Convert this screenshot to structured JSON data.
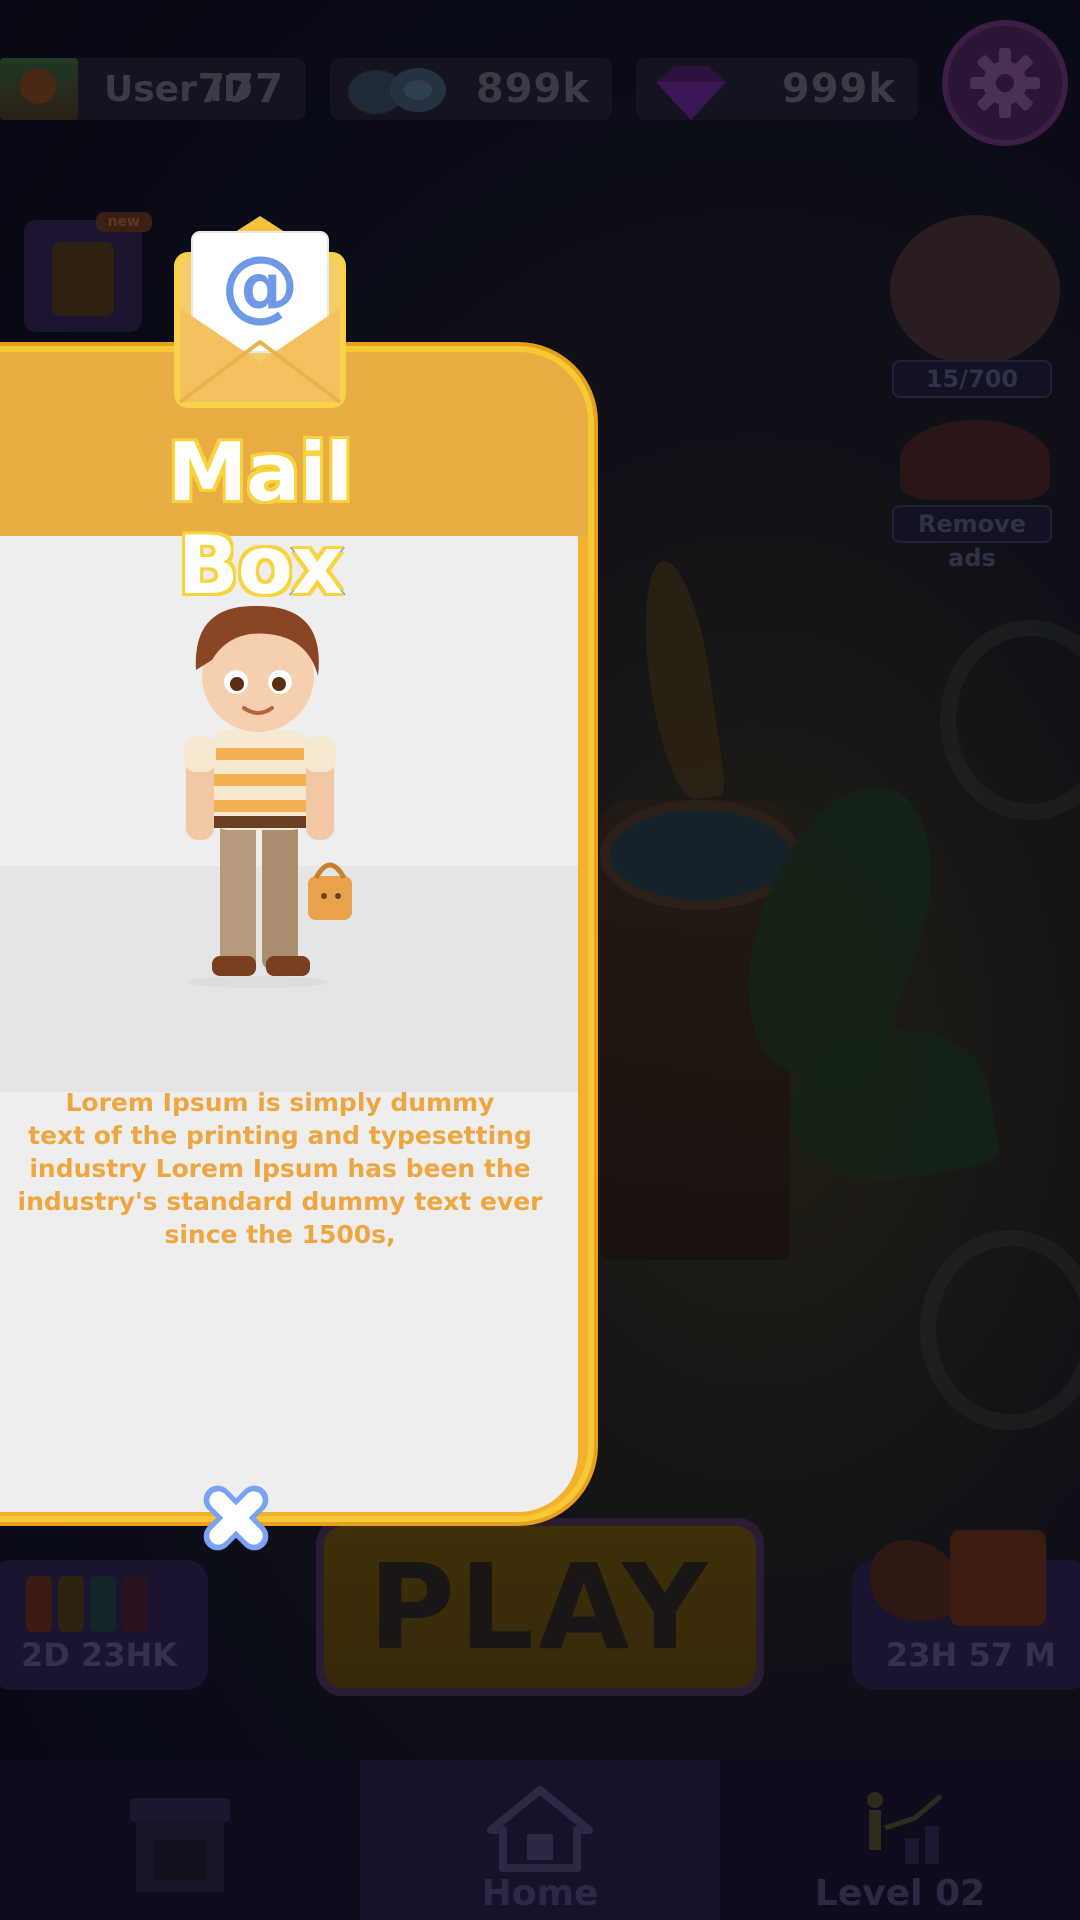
{
  "topbar": {
    "user_id_label": "User ID",
    "user_id_value": "777",
    "chips_value": "899k",
    "gems_value": "999k",
    "settings_icon": "gear-icon"
  },
  "side_widgets": {
    "tasks_new_tag": "new",
    "piggy_progress": "15/700",
    "remove_ads_label": "Remove ads"
  },
  "bottom": {
    "left_timer": "2D 23HK",
    "play_label": "PLAY",
    "right_timer": "23H 57 M"
  },
  "navbar": {
    "items": [
      {
        "label": "",
        "icon": "shop-icon"
      },
      {
        "label": "Home",
        "icon": "home-icon"
      },
      {
        "label": "Level 02",
        "icon": "level-icon"
      }
    ]
  },
  "mailbox": {
    "title": "Mail Box",
    "envelope_icon": "envelope-at-icon",
    "message": "Lorem Ipsum is simply dummy\n      text of the printing and typesetting\nindustry Lorem Ipsum has been the\nindustry's standard dummy text ever\nsince the 1500s,",
    "close_icon": "close-icon"
  },
  "colors": {
    "panel_gold": "#f3b22e",
    "title_blue": "#7aa2f2",
    "message_orange": "#eea640",
    "body_bg": "#efeeee"
  }
}
